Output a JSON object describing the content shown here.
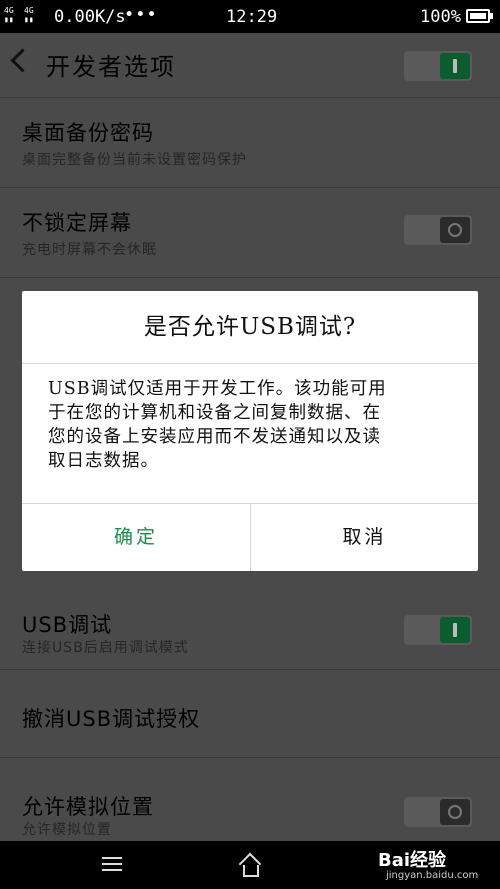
{
  "status_bar": {
    "signal1": "4G",
    "signal2": "4G",
    "network_speed": "0.00K/s",
    "dots": "•••",
    "time": "12:29",
    "battery": "100%"
  },
  "header": {
    "title": "开发者选项",
    "master_switch": "on"
  },
  "settings": [
    {
      "title": "桌面备份密码",
      "subtitle": "桌面完整备份当前未设置密码保护"
    },
    {
      "title": "不锁定屏幕",
      "subtitle": "充电时屏幕不会休眠",
      "switch": "off"
    },
    {
      "title": "USB调试",
      "subtitle": "连接USB后启用调试模式",
      "switch": "on"
    },
    {
      "title": "撤消USB调试授权"
    },
    {
      "title": "允许模拟位置",
      "subtitle": "允许模拟位置",
      "switch": "off"
    }
  ],
  "dialog": {
    "title": "是否允许USB调试?",
    "message_lines": [
      "USB调试仅适用于开发工作。该功能可用",
      "于在您的计算机和设备之间复制数据、在",
      "您的设备上安装应用而不发送通知以及读",
      "取日志数据。"
    ],
    "ok_label": "确定",
    "cancel_label": "取消",
    "accent_color": "#1e8a4a"
  },
  "watermark": {
    "brand": "Bai经验",
    "url": "jingyan.baidu.com"
  }
}
